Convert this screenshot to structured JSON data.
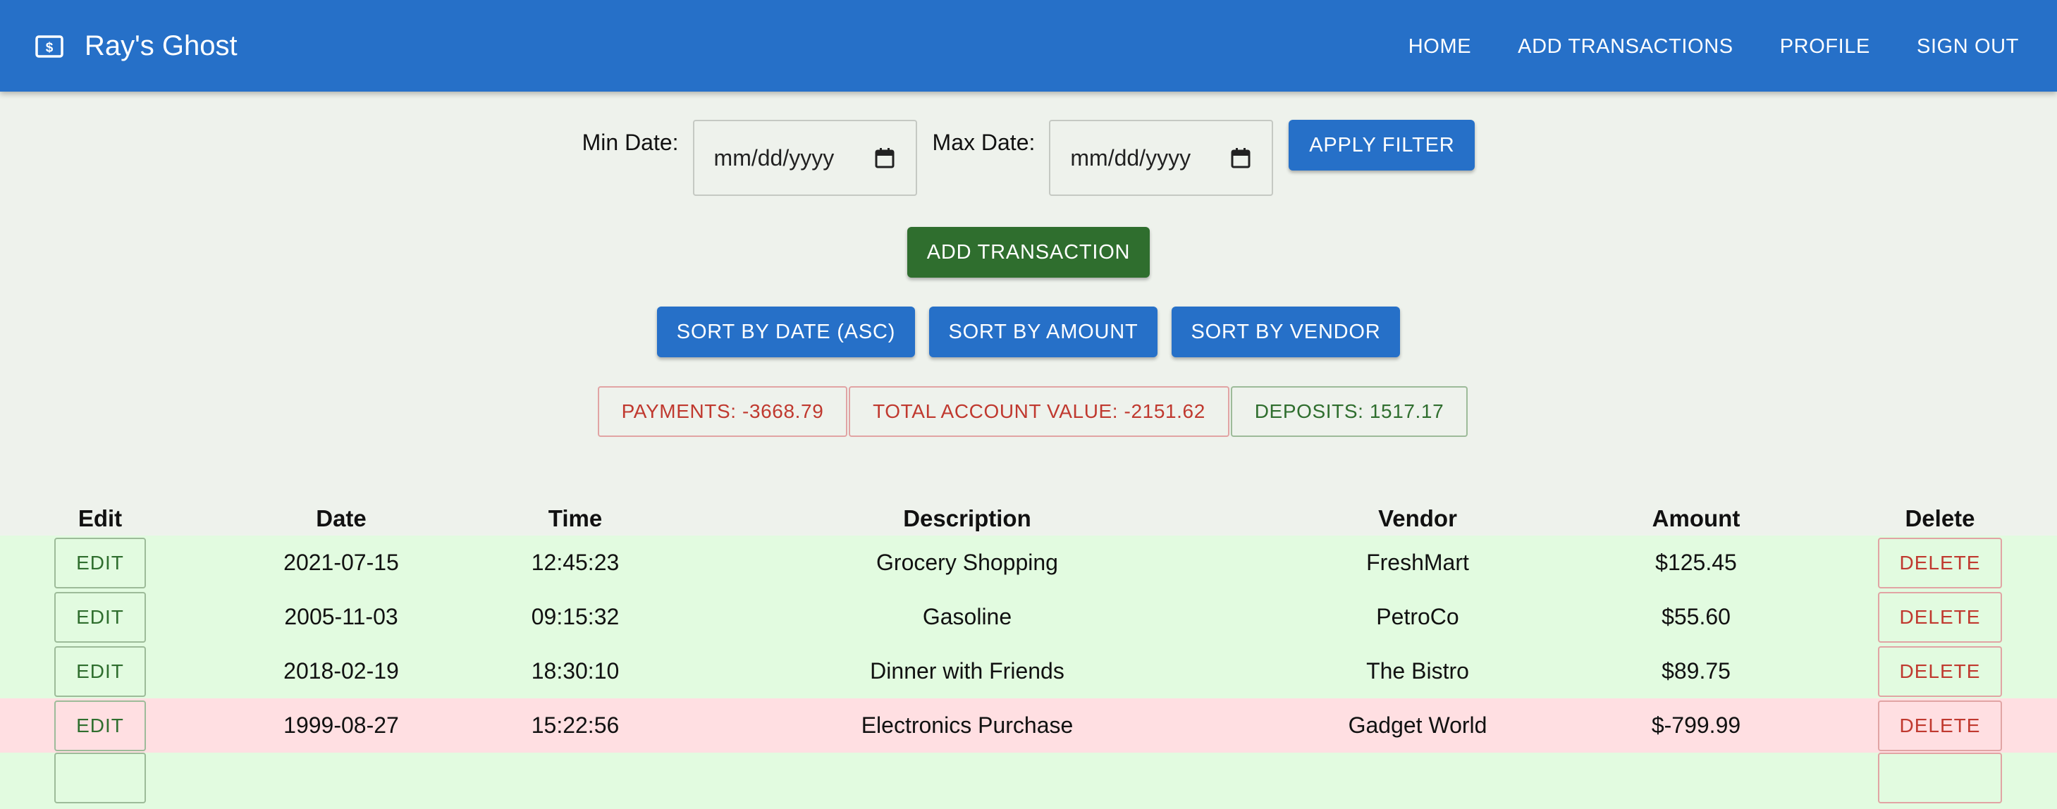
{
  "app": {
    "title": "Ray's Ghost",
    "icon": "money-icon"
  },
  "nav": {
    "home": "HOME",
    "add_transactions": "ADD TRANSACTIONS",
    "profile": "PROFILE",
    "sign_out": "SIGN OUT"
  },
  "filter": {
    "min_label": "Min Date:",
    "min_value": "mm/dd/yyyy",
    "max_label": "Max Date:",
    "max_value": "mm/dd/yyyy",
    "apply_label": "APPLY FILTER"
  },
  "add_transaction_label": "ADD TRANSACTION",
  "sort": {
    "date": "SORT BY DATE (ASC)",
    "amount": "SORT BY AMOUNT",
    "vendor": "SORT BY VENDOR"
  },
  "summary": {
    "payments": "PAYMENTS: -3668.79",
    "total": "TOTAL ACCOUNT VALUE: -2151.62",
    "deposits": "DEPOSITS: 1517.17"
  },
  "table": {
    "headers": {
      "edit": "Edit",
      "date": "Date",
      "time": "Time",
      "description": "Description",
      "vendor": "Vendor",
      "amount": "Amount",
      "delete": "Delete"
    },
    "edit_label": "EDIT",
    "delete_label": "DELETE",
    "rows": [
      {
        "date": "2021-07-15",
        "time": "12:45:23",
        "description": "Grocery Shopping",
        "vendor": "FreshMart",
        "amount": "$125.45"
      },
      {
        "date": "2005-11-03",
        "time": "09:15:32",
        "description": "Gasoline",
        "vendor": "PetroCo",
        "amount": "$55.60"
      },
      {
        "date": "2018-02-19",
        "time": "18:30:10",
        "description": "Dinner with Friends",
        "vendor": "The Bistro",
        "amount": "$89.75"
      },
      {
        "date": "1999-08-27",
        "time": "15:22:56",
        "description": "Electronics Purchase",
        "vendor": "Gadget World",
        "amount": "$-799.99"
      }
    ]
  },
  "colors": {
    "appbar": "#2670c8",
    "background": "#eef2ec",
    "primary_button": "#2670c8",
    "add_button": "#2f6e2e",
    "positive_row": "#e2fbe0",
    "negative_row": "#ffdfe2",
    "negative_text": "#c0392f",
    "positive_text": "#2f6e2e"
  }
}
